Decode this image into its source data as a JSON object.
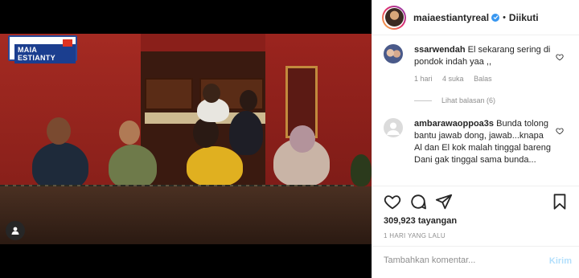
{
  "video": {
    "logo_text": "MAIA ESTIANTY"
  },
  "post": {
    "username": "maiaestiantyreal",
    "separator": "•",
    "follow_label": "Diikuti"
  },
  "comments": [
    {
      "username": "ssarwendah",
      "text": "El sekarang sering di pondok indah yaa ,,",
      "time": "1 hari",
      "likes": "4 suka",
      "reply_label": "Balas",
      "view_replies": "Lihat balasan (6)"
    },
    {
      "username": "ambarawaoppoa3s",
      "text": "Bunda tolong bantu jawab dong, jawab...knapa Al dan El kok malah tinggal bareng Dani gak tinggal sama bunda..."
    }
  ],
  "stats": {
    "views": "309,923 tayangan",
    "time_ago": "1 HARI YANG LALU"
  },
  "composer": {
    "placeholder": "Tambahkan komentar...",
    "send_label": "Kirim"
  },
  "colors": {
    "verified": "#3897f0",
    "send_disabled": "#b2dffc",
    "muted": "#8e8e8e"
  }
}
